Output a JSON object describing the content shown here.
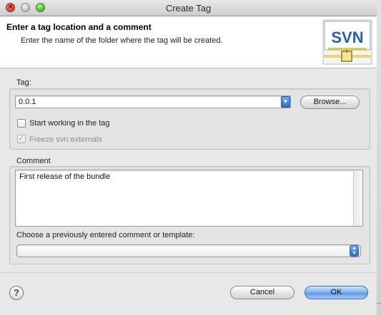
{
  "window": {
    "title": "Create Tag"
  },
  "header": {
    "title": "Enter a tag location and a comment",
    "subtitle": "Enter the name of the folder where the tag will be created.",
    "logo_text": "SVN"
  },
  "tag": {
    "label": "Tag:",
    "value": "0.0.1",
    "browse_label": "Browse...",
    "start_working_label": "Start working in the tag",
    "start_working_checked": false,
    "freeze_label": "Freeze svn:externals",
    "freeze_checked": true,
    "freeze_enabled": false
  },
  "comment": {
    "label": "Comment",
    "value": "First release of the bundle",
    "template_label": "Choose a previously entered comment or template:",
    "template_value": ""
  },
  "buttons": {
    "cancel": "Cancel",
    "ok": "OK"
  },
  "icons": {
    "help": "?"
  }
}
